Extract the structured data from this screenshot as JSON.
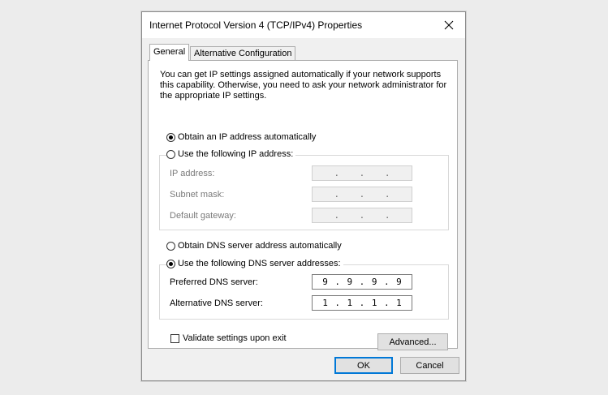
{
  "window": {
    "title": "Internet Protocol Version 4 (TCP/IPv4) Properties",
    "close_icon": "close-icon"
  },
  "tabs": [
    {
      "label": "General",
      "selected": true
    },
    {
      "label": "Alternative Configuration",
      "selected": false
    }
  ],
  "general": {
    "description": "You can get IP settings assigned automatically if your network supports this capability. Otherwise, you need to ask your network administrator for the appropriate IP settings.",
    "ip_mode": {
      "auto_label": "Obtain an IP address automatically",
      "manual_label": "Use the following IP address:",
      "selected": "auto"
    },
    "ip_fields": {
      "ip_address_label": "IP address:",
      "subnet_mask_label": "Subnet mask:",
      "default_gateway_label": "Default gateway:",
      "ip_address": [
        "",
        "",
        "",
        ""
      ],
      "subnet_mask": [
        "",
        "",
        "",
        ""
      ],
      "default_gateway": [
        "",
        "",
        "",
        ""
      ]
    },
    "dns_mode": {
      "auto_label": "Obtain DNS server address automatically",
      "manual_label": "Use the following DNS server addresses:",
      "selected": "manual"
    },
    "dns_fields": {
      "preferred_label": "Preferred DNS server:",
      "alternative_label": "Alternative DNS server:",
      "preferred": [
        "9",
        "9",
        "9",
        "9"
      ],
      "alternative": [
        "1",
        "1",
        "1",
        "1"
      ]
    },
    "validate_label": "Validate settings upon exit",
    "validate_checked": false,
    "advanced_label": "Advanced..."
  },
  "footer": {
    "ok_label": "OK",
    "cancel_label": "Cancel"
  },
  "colors": {
    "default_button_border": "#0078d7"
  }
}
